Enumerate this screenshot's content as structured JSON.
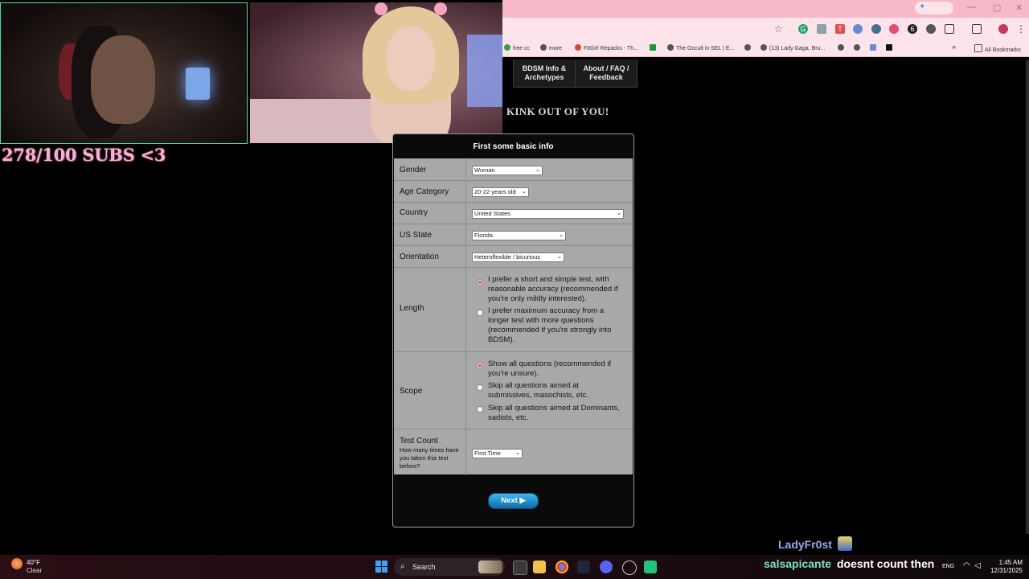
{
  "overlay": {
    "subs_text": "278/100 SUBS <3",
    "chat": [
      {
        "user": "LadyFr0st",
        "message": ""
      },
      {
        "user": "salsapicante",
        "message": "doesnt count then"
      }
    ]
  },
  "browser": {
    "bookmarks": [
      "free cc",
      "more",
      "FitGirl Repacks - Th...",
      "The Occult in SEL | E...",
      "(13) Lady Gaga, Bru..."
    ],
    "all_bookmarks": "All Bookmarks",
    "overflow": "»",
    "extension_icons": [
      "grammarly-icon",
      "translate-icon",
      "tp-icon",
      "reader-icon",
      "privacy-icon",
      "adblock-icon",
      "counter-icon",
      "puzzle-icon",
      "sidepanel-icon",
      "profile-icon"
    ]
  },
  "site": {
    "nav": [
      {
        "label": "BDSM Info & Archetypes"
      },
      {
        "label": "About / FAQ / Feedback"
      }
    ],
    "tagline": "KINK OUT OF YOU!"
  },
  "form": {
    "title": "First some basic info",
    "fields": {
      "gender": {
        "label": "Gender",
        "value": "Woman"
      },
      "age": {
        "label": "Age Category",
        "value": "20-22 years old"
      },
      "country": {
        "label": "Country",
        "value": "United States"
      },
      "state": {
        "label": "US State",
        "value": "Florida"
      },
      "orientation": {
        "label": "Orientation",
        "value": "Heteroflexible / bicurious"
      },
      "length": {
        "label": "Length",
        "options": [
          {
            "text": "I prefer a short and simple test, with reasonable accuracy (recommended if you're only mildly interested).",
            "selected": true
          },
          {
            "text": "I prefer maximum accuracy from a longer test with more questions (recommended if you're strongly into BDSM).",
            "selected": false
          }
        ]
      },
      "scope": {
        "label": "Scope",
        "options": [
          {
            "text": "Show all questions (recommended if you're unsure).",
            "selected": true
          },
          {
            "text": "Skip all questions aimed at submissives, masochists, etc.",
            "selected": false
          },
          {
            "text": "Skip all questions aimed at Dominants, sadists, etc.",
            "selected": false
          }
        ]
      },
      "test_count": {
        "label": "Test Count",
        "sublabel": "How many times have you taken this test before?",
        "value": "First Time"
      }
    },
    "next_label": "Next ▶"
  },
  "taskbar": {
    "weather_temp": "40°F",
    "weather_cond": "Clear",
    "search_placeholder": "Search",
    "lang": "ENG",
    "time": "1:45 AM",
    "date": "12/31/2025"
  },
  "colors": {
    "accent_pink": "#f7b8c8",
    "subs_pink": "#f4b3d0",
    "radio_selected": "#d9468c",
    "next_button": "#1a8fd0",
    "form_bg": "#a8a8a8"
  }
}
